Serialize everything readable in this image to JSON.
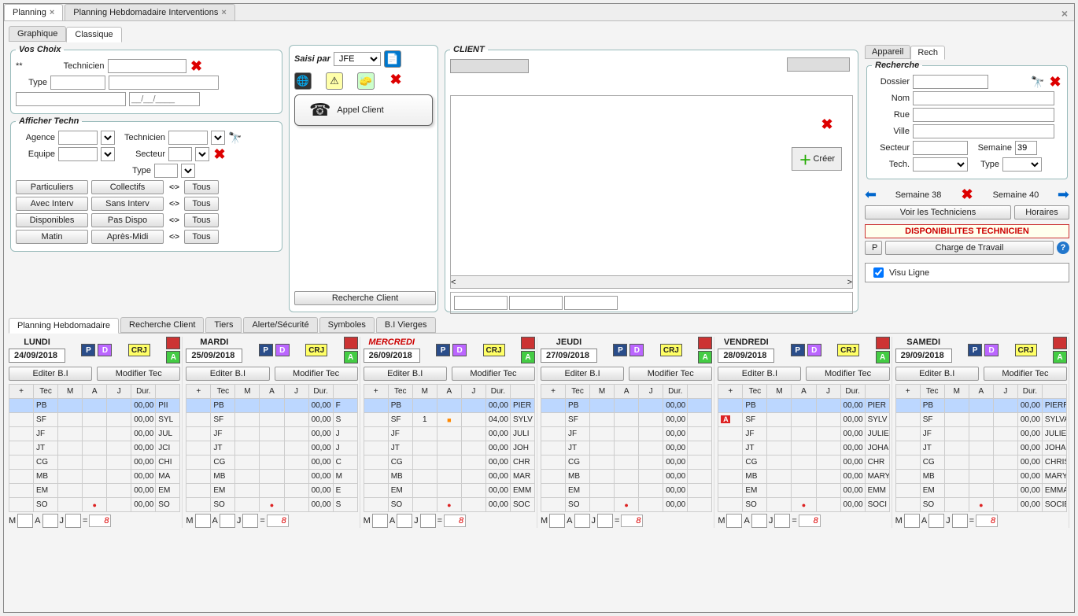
{
  "tabs": {
    "top": [
      "Planning",
      "Planning Hebdomadaire Interventions"
    ],
    "sub": [
      "Graphique",
      "Classique"
    ]
  },
  "vos_choix": {
    "legend": "Vos Choix",
    "technicien": "Technicien",
    "type": "Type",
    "stars": "**",
    "date_mask": "__/__/____"
  },
  "afficher": {
    "legend": "Afficher Techn",
    "technicien": "Technicien",
    "agence": "Agence",
    "secteur": "Secteur",
    "equipe": "Equipe",
    "type": "Type",
    "btns": {
      "particuliers": "Particuliers",
      "collectifs": "Collectifs",
      "avec": "Avec Interv",
      "sans": "Sans Interv",
      "dispo": "Disponibles",
      "pasdispo": "Pas Dispo",
      "matin": "Matin",
      "apres": "Après-Midi",
      "tous": "Tous"
    }
  },
  "middle": {
    "saisi_par": "Saisi par",
    "saisi_val": "JFE",
    "appel": "Appel Client",
    "recherche_client": "Recherche Client"
  },
  "client": {
    "legend": "CLIENT",
    "creer": "Créer"
  },
  "right": {
    "tabs": [
      "Appareil",
      "Rech"
    ],
    "legend": "Recherche",
    "dossier": "Dossier",
    "nom": "Nom",
    "rue": "Rue",
    "ville": "Ville",
    "secteur": "Secteur",
    "tech": "Tech.",
    "semaine": "Semaine",
    "type": "Type",
    "semaine_val": "39",
    "prev": "Semaine 38",
    "next": "Semaine 40",
    "voir": "Voir les Techniciens",
    "horaires": "Horaires",
    "dispo": "DISPONIBILITES TECHNICIEN",
    "p": "P",
    "charge": "Charge de Travail",
    "visu": "Visu Ligne"
  },
  "btabs": [
    "Planning Hebdomadaire",
    "Recherche Client",
    "Tiers",
    "Alerte/Sécurité",
    "Symboles",
    "B.I Vierges"
  ],
  "day_common": {
    "editer": "Editer B.I",
    "modifier": "Modifier Tec",
    "cols": [
      "+",
      "Tec",
      "M",
      "A",
      "J",
      "Dur.",
      ""
    ],
    "footer": {
      "m": "M",
      "a": "A",
      "j": "J",
      "eq": "=",
      "out": "8"
    },
    "badges": {
      "p": "P",
      "d": "D",
      "crj": "CRJ",
      "a": "A"
    }
  },
  "days": [
    {
      "name": "LUNDI",
      "date": "24/09/2018",
      "today": false,
      "rows": [
        {
          "tec": "PB",
          "m": "",
          "a": "",
          "j": "",
          "dur": "00,00",
          "nom": "PII",
          "sel": true
        },
        {
          "tec": "SF",
          "m": "",
          "a": "",
          "j": "",
          "dur": "00,00",
          "nom": "SYL"
        },
        {
          "tec": "JF",
          "m": "",
          "a": "",
          "j": "",
          "dur": "00,00",
          "nom": "JUL"
        },
        {
          "tec": "JT",
          "m": "",
          "a": "",
          "j": "",
          "dur": "00,00",
          "nom": "JCI"
        },
        {
          "tec": "CG",
          "m": "",
          "a": "",
          "j": "",
          "dur": "00,00",
          "nom": "CHI"
        },
        {
          "tec": "MB",
          "m": "",
          "a": "",
          "j": "",
          "dur": "00,00",
          "nom": "MA"
        },
        {
          "tec": "EM",
          "m": "",
          "a": "",
          "j": "",
          "dur": "00,00",
          "nom": "EM"
        },
        {
          "tec": "SO",
          "m": "",
          "a": "red",
          "j": "",
          "dur": "00,00",
          "nom": "SO"
        }
      ]
    },
    {
      "name": "MARDI",
      "date": "25/09/2018",
      "today": false,
      "rows": [
        {
          "tec": "PB",
          "m": "",
          "a": "",
          "j": "",
          "dur": "00,00",
          "nom": "F",
          "sel": true
        },
        {
          "tec": "SF",
          "m": "",
          "a": "",
          "j": "",
          "dur": "00,00",
          "nom": "S"
        },
        {
          "tec": "JF",
          "m": "",
          "a": "",
          "j": "",
          "dur": "00,00",
          "nom": "J"
        },
        {
          "tec": "JT",
          "m": "",
          "a": "",
          "j": "",
          "dur": "00,00",
          "nom": "J"
        },
        {
          "tec": "CG",
          "m": "",
          "a": "",
          "j": "",
          "dur": "00,00",
          "nom": "C"
        },
        {
          "tec": "MB",
          "m": "",
          "a": "",
          "j": "",
          "dur": "00,00",
          "nom": "M"
        },
        {
          "tec": "EM",
          "m": "",
          "a": "",
          "j": "",
          "dur": "00,00",
          "nom": "E"
        },
        {
          "tec": "SO",
          "m": "",
          "a": "red",
          "j": "",
          "dur": "00,00",
          "nom": "S"
        }
      ]
    },
    {
      "name": "MERCREDI",
      "date": "26/09/2018",
      "today": true,
      "rows": [
        {
          "tec": "PB",
          "m": "",
          "a": "",
          "j": "",
          "dur": "00,00",
          "nom": "PIER",
          "sel": true
        },
        {
          "tec": "SF",
          "m": "1",
          "a": "org",
          "j": "",
          "dur": "04,00",
          "nom": "SYLV"
        },
        {
          "tec": "JF",
          "m": "",
          "a": "",
          "j": "",
          "dur": "00,00",
          "nom": "JULI"
        },
        {
          "tec": "JT",
          "m": "",
          "a": "",
          "j": "",
          "dur": "00,00",
          "nom": "JOH"
        },
        {
          "tec": "CG",
          "m": "",
          "a": "",
          "j": "",
          "dur": "00,00",
          "nom": "CHR"
        },
        {
          "tec": "MB",
          "m": "",
          "a": "",
          "j": "",
          "dur": "00,00",
          "nom": "MAR"
        },
        {
          "tec": "EM",
          "m": "",
          "a": "",
          "j": "",
          "dur": "00,00",
          "nom": "EMM"
        },
        {
          "tec": "SO",
          "m": "",
          "a": "red",
          "j": "",
          "dur": "00,00",
          "nom": "SOC"
        }
      ]
    },
    {
      "name": "JEUDI",
      "date": "27/09/2018",
      "today": false,
      "rows": [
        {
          "tec": "PB",
          "m": "",
          "a": "",
          "j": "",
          "dur": "00,00",
          "nom": "",
          "sel": true
        },
        {
          "tec": "SF",
          "m": "",
          "a": "",
          "j": "",
          "dur": "00,00",
          "nom": ""
        },
        {
          "tec": "JF",
          "m": "",
          "a": "",
          "j": "",
          "dur": "00,00",
          "nom": ""
        },
        {
          "tec": "JT",
          "m": "",
          "a": "",
          "j": "",
          "dur": "00,00",
          "nom": ""
        },
        {
          "tec": "CG",
          "m": "",
          "a": "",
          "j": "",
          "dur": "00,00",
          "nom": ""
        },
        {
          "tec": "MB",
          "m": "",
          "a": "",
          "j": "",
          "dur": "00,00",
          "nom": ""
        },
        {
          "tec": "EM",
          "m": "",
          "a": "",
          "j": "",
          "dur": "00,00",
          "nom": ""
        },
        {
          "tec": "SO",
          "m": "",
          "a": "red",
          "j": "",
          "dur": "00,00",
          "nom": ""
        }
      ]
    },
    {
      "name": "VENDREDI",
      "date": "28/09/2018",
      "today": false,
      "rows": [
        {
          "tec": "PB",
          "m": "",
          "a": "",
          "j": "",
          "dur": "00,00",
          "nom": "PIER",
          "sel": true
        },
        {
          "tec": "SF",
          "m": "Ared",
          "a": "",
          "j": "",
          "dur": "00,00",
          "nom": "SYLV"
        },
        {
          "tec": "JF",
          "m": "",
          "a": "",
          "j": "",
          "dur": "00,00",
          "nom": "JULIE"
        },
        {
          "tec": "JT",
          "m": "",
          "a": "",
          "j": "",
          "dur": "00,00",
          "nom": "JOHA"
        },
        {
          "tec": "CG",
          "m": "",
          "a": "",
          "j": "",
          "dur": "00,00",
          "nom": "CHR"
        },
        {
          "tec": "MB",
          "m": "",
          "a": "",
          "j": "",
          "dur": "00,00",
          "nom": "MARY"
        },
        {
          "tec": "EM",
          "m": "",
          "a": "",
          "j": "",
          "dur": "00,00",
          "nom": "EMM"
        },
        {
          "tec": "SO",
          "m": "",
          "a": "red",
          "j": "",
          "dur": "00,00",
          "nom": "SOCI"
        }
      ]
    },
    {
      "name": "SAMEDI",
      "date": "29/09/2018",
      "today": false,
      "rows": [
        {
          "tec": "PB",
          "m": "",
          "a": "",
          "j": "",
          "dur": "00,00",
          "nom": "PIERRE",
          "sel": true
        },
        {
          "tec": "SF",
          "m": "",
          "a": "",
          "j": "",
          "dur": "00,00",
          "nom": "SYLVAIN"
        },
        {
          "tec": "JF",
          "m": "",
          "a": "",
          "j": "",
          "dur": "00,00",
          "nom": "JULIEN"
        },
        {
          "tec": "JT",
          "m": "",
          "a": "",
          "j": "",
          "dur": "00,00",
          "nom": "JOHANN"
        },
        {
          "tec": "CG",
          "m": "",
          "a": "",
          "j": "",
          "dur": "00,00",
          "nom": "CHRIST"
        },
        {
          "tec": "MB",
          "m": "",
          "a": "",
          "j": "",
          "dur": "00,00",
          "nom": "MARYSE"
        },
        {
          "tec": "EM",
          "m": "",
          "a": "",
          "j": "",
          "dur": "00,00",
          "nom": "EMMANU"
        },
        {
          "tec": "SO",
          "m": "",
          "a": "red",
          "j": "",
          "dur": "00,00",
          "nom": "SOCIET"
        }
      ]
    }
  ]
}
